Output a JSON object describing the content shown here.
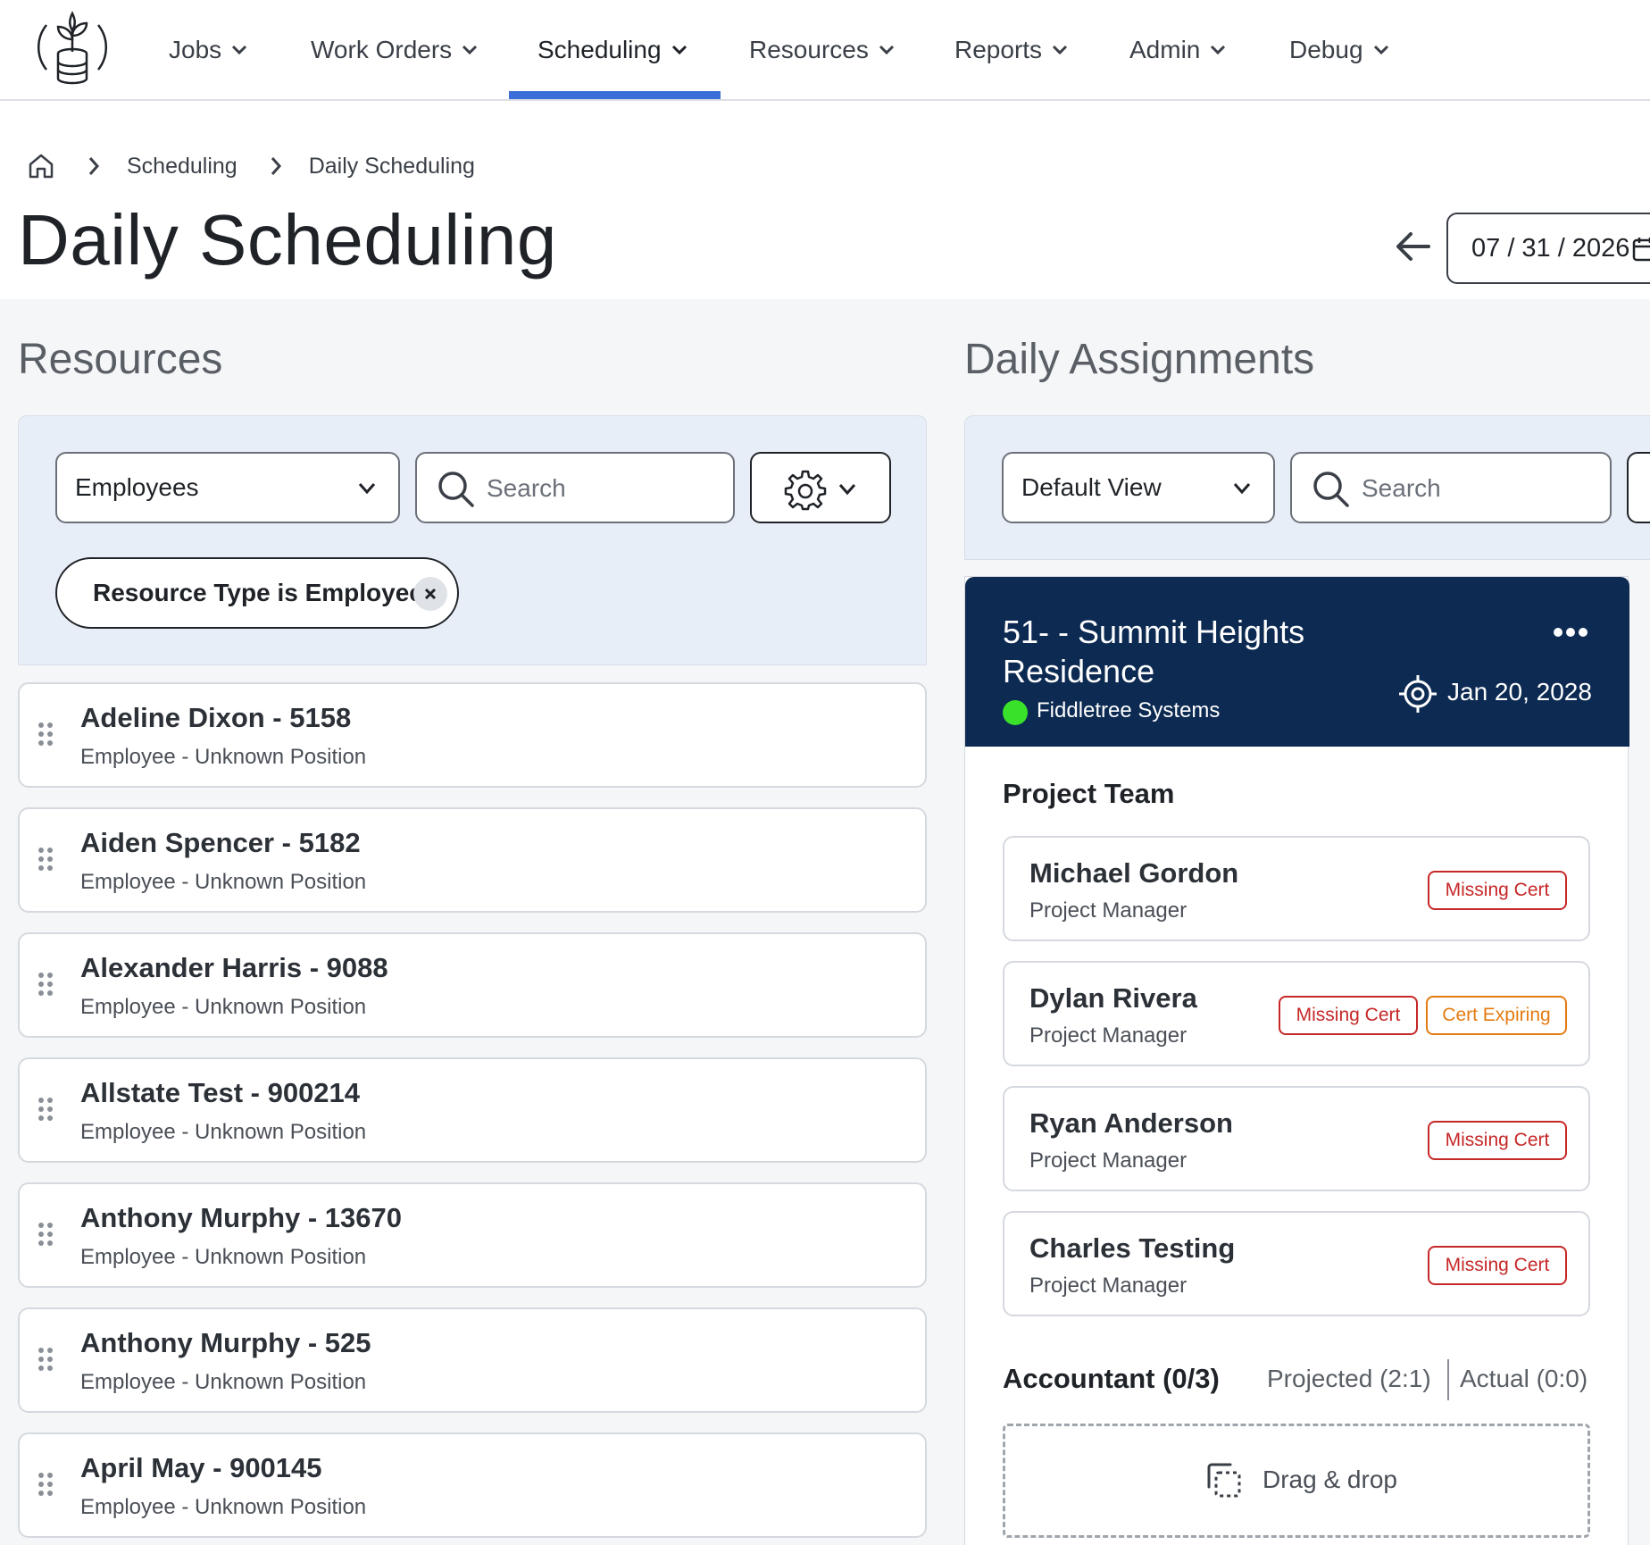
{
  "nav": {
    "items": [
      {
        "label": "Jobs"
      },
      {
        "label": "Work Orders"
      },
      {
        "label": "Scheduling"
      },
      {
        "label": "Resources"
      },
      {
        "label": "Reports"
      },
      {
        "label": "Admin"
      },
      {
        "label": "Debug"
      }
    ],
    "active": "Scheduling",
    "accent": "#3b6fd8"
  },
  "breadcrumb": {
    "items": [
      "Scheduling",
      "Daily Scheduling"
    ]
  },
  "page": {
    "title": "Daily Scheduling",
    "date": "07 / 31 / 2026"
  },
  "resources": {
    "title": "Resources",
    "type_select": "Employees",
    "search_placeholder": "Search",
    "filter_chip": "Resource Type is Employee",
    "items": [
      {
        "name": "Adeline Dixon - 5158",
        "sub": "Employee - Unknown Position"
      },
      {
        "name": "Aiden Spencer - 5182",
        "sub": "Employee - Unknown Position"
      },
      {
        "name": "Alexander Harris - 9088",
        "sub": "Employee - Unknown Position"
      },
      {
        "name": "Allstate Test - 900214",
        "sub": "Employee - Unknown Position"
      },
      {
        "name": "Anthony Murphy - 13670",
        "sub": "Employee - Unknown Position"
      },
      {
        "name": "Anthony Murphy - 525",
        "sub": "Employee - Unknown Position"
      },
      {
        "name": "April May - 900145",
        "sub": "Employee - Unknown Position"
      }
    ]
  },
  "assignments": {
    "title": "Daily Assignments",
    "view_select": "Default View",
    "search_placeholder": "Search",
    "job": {
      "title": "51- - Summit Heights Residence",
      "company": "Fiddletree Systems",
      "status_color": "#39e12b",
      "date": "Jan 20, 2028",
      "header_color": "#0c2a52"
    },
    "project_team": {
      "title": "Project Team",
      "members": [
        {
          "name": "Michael Gordon",
          "role": "Project Manager",
          "badges": [
            "Missing Cert"
          ]
        },
        {
          "name": "Dylan Rivera",
          "role": "Project Manager",
          "badges": [
            "Missing Cert",
            "Cert Expiring"
          ]
        },
        {
          "name": "Ryan Anderson",
          "role": "Project Manager",
          "badges": [
            "Missing Cert"
          ]
        },
        {
          "name": "Charles Testing",
          "role": "Project Manager",
          "badges": [
            "Missing Cert"
          ]
        }
      ]
    },
    "accountant": {
      "title": "Accountant (0/3)",
      "projected": "Projected (2:1)",
      "actual": "Actual (0:0)",
      "dropzone": "Drag & drop"
    }
  }
}
